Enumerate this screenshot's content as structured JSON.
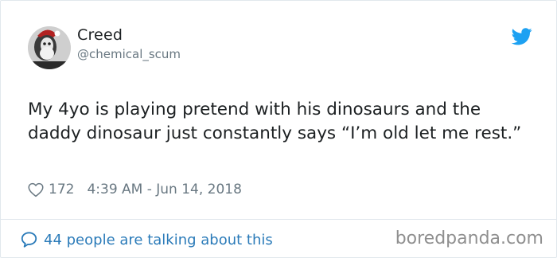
{
  "user": {
    "display_name": "Creed",
    "handle": "@chemical_scum",
    "avatar": "avatar-icon"
  },
  "tweet": {
    "text": "My 4yo is playing pretend with his dinosaurs and the daddy dinosaur just constantly says “I’m old let me rest.”",
    "likes": "172",
    "timestamp": "4:39 AM - Jun 14, 2018"
  },
  "footer": {
    "talking": "44 people are talking about this",
    "watermark": "boredpanda.com"
  },
  "icons": {
    "brand": "twitter-bird-icon",
    "like": "heart-icon",
    "reply": "speech-bubble-icon"
  },
  "colors": {
    "brand_blue": "#1da1f2",
    "link_blue": "#2b7bb9",
    "text": "#1c2022",
    "muted": "#697882"
  }
}
